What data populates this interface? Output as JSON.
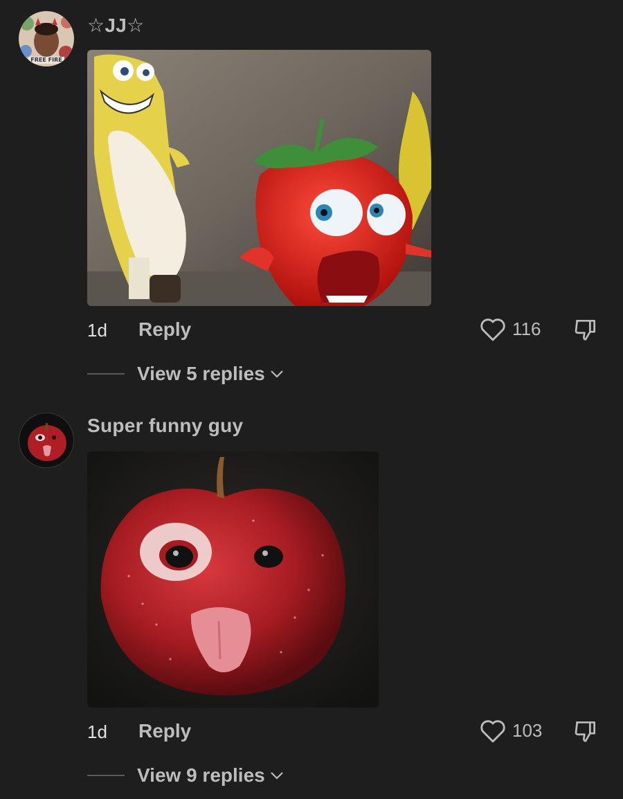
{
  "colors": {
    "background": "#1e1e1e",
    "text_secondary": "#bdbdbd",
    "text_primary": "#e2e2e2"
  },
  "comments": [
    {
      "username": "☆JJ☆",
      "avatar_badge_text": "FREE FIRE",
      "media_description": "cartoon banana and strawberry image",
      "time": "1d",
      "reply_label": "Reply",
      "like_count": "116",
      "view_replies_label": "View 5 replies",
      "icons": {
        "like": "heart-outline-icon",
        "dislike": "thumbs-down-outline-icon",
        "expand": "chevron-down-icon"
      }
    },
    {
      "username": "Super funny guy",
      "media_description": "apple with face and tongue image",
      "time": "1d",
      "reply_label": "Reply",
      "like_count": "103",
      "view_replies_label": "View 9 replies",
      "icons": {
        "like": "heart-outline-icon",
        "dislike": "thumbs-down-outline-icon",
        "expand": "chevron-down-icon"
      }
    }
  ]
}
